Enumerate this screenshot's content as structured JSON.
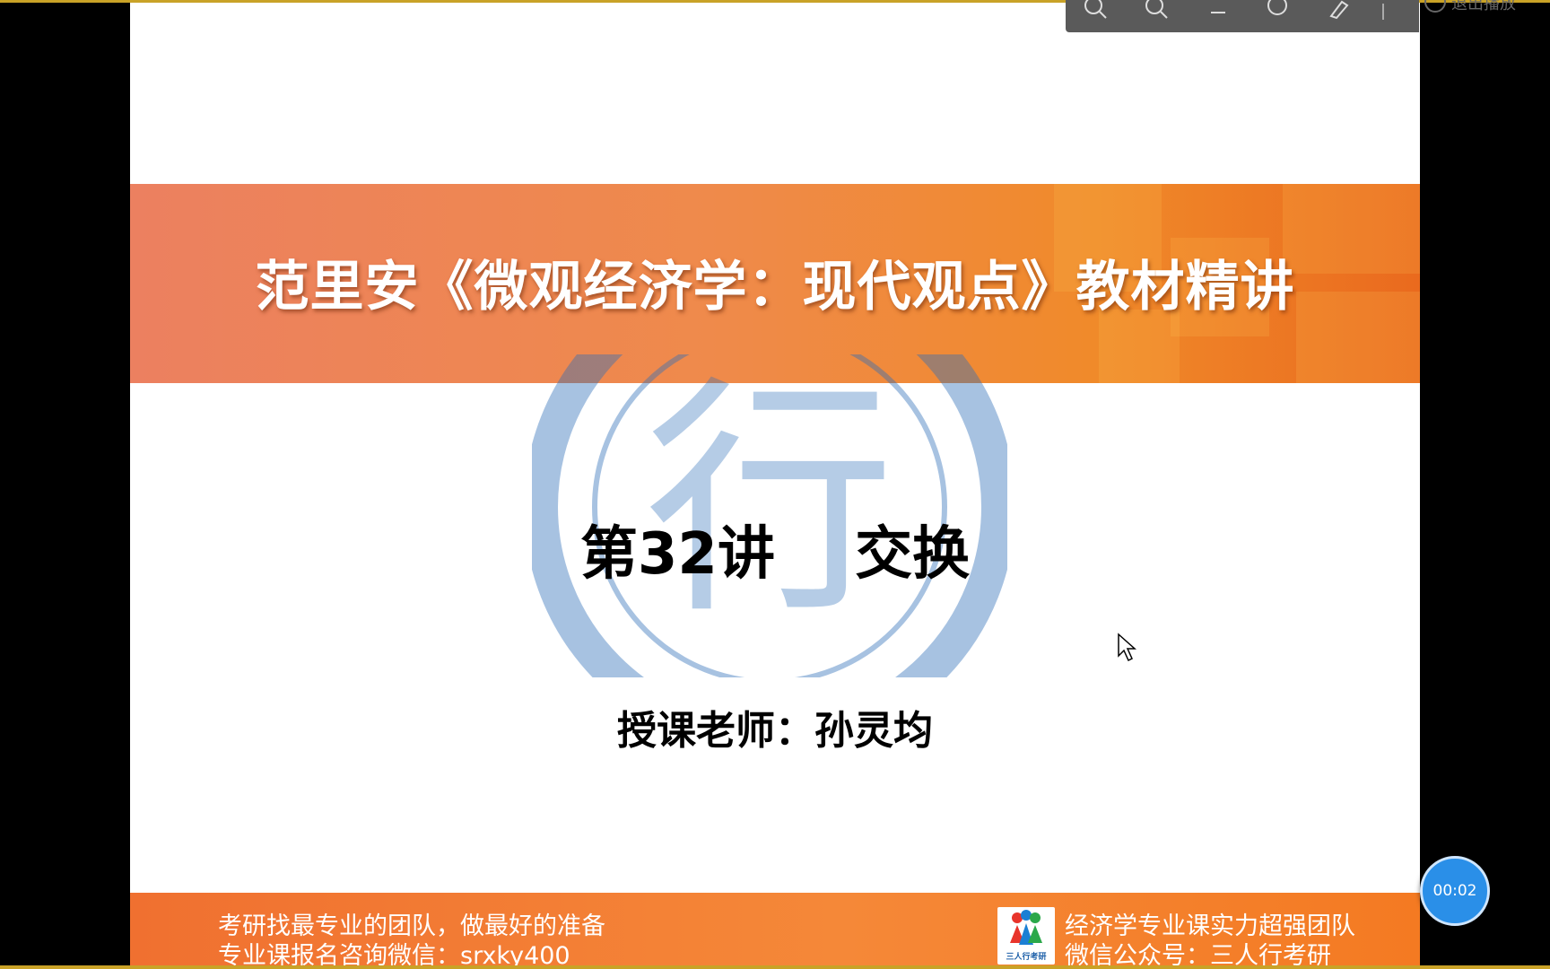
{
  "slide": {
    "banner_title": "范里安《微观经济学：现代观点》教材精讲",
    "lecture_title": "第32讲    交换",
    "teacher": "授课老师：孙灵均",
    "watermark_char": "行"
  },
  "footer": {
    "left_line1": "考研找最专业的团队，做最好的准备",
    "left_line2": "专业课报名咨询微信：srxky400",
    "right_line1": "经济学专业课实力超强团队",
    "right_line2": "微信公众号：三人行考研",
    "logo_caption": "三人行考研"
  },
  "toolbar": {
    "exit_label": "退出播放"
  },
  "timer": {
    "value": "00:02"
  }
}
